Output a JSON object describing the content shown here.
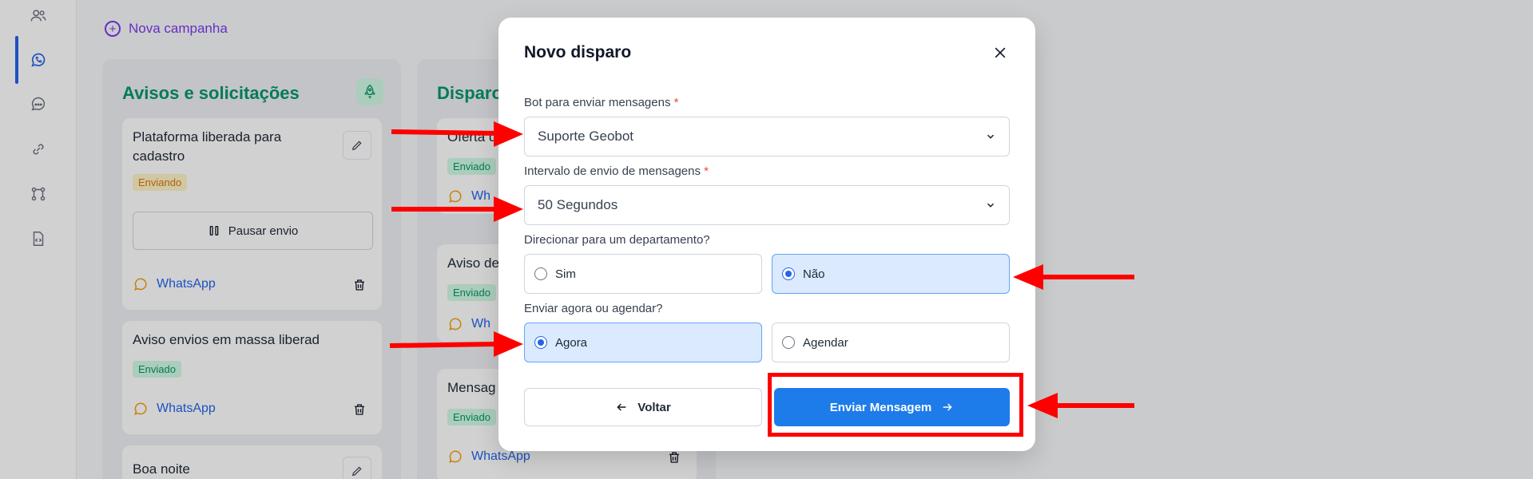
{
  "page": {
    "new_campaign": "Nova campanha"
  },
  "columns": [
    {
      "title": "Avisos e solicitações",
      "cards": [
        {
          "title_line1": "Plataforma liberada para",
          "title_line2": "cadastro",
          "status": "Enviando",
          "pause_label": "Pausar envio",
          "channel": "WhatsApp"
        },
        {
          "title_line1": "Aviso envios em massa liberad",
          "status": "Enviado",
          "channel": "WhatsApp"
        },
        {
          "title_line1": "Boa noite"
        }
      ]
    },
    {
      "title": "Disparo",
      "cards": [
        {
          "title_line1": "Oferta d",
          "status": "Enviado",
          "channel": "Wh"
        },
        {
          "title_line1": "Aviso de",
          "status": "Enviado",
          "channel": "Wh"
        },
        {
          "title_line1": "Mensag",
          "status": "Enviado",
          "channel": "WhatsApp"
        }
      ]
    }
  ],
  "modal": {
    "title": "Novo disparo",
    "bot_label": "Bot para enviar mensagens",
    "required_mark": "*",
    "bot_value": "Suporte Geobot",
    "interval_label": "Intervalo de envio de mensagens",
    "interval_value": "50 Segundos",
    "department_label": "Direcionar para um departamento?",
    "department_options": [
      "Sim",
      "Não"
    ],
    "department_selected": "Não",
    "schedule_label": "Enviar agora ou agendar?",
    "schedule_options": [
      "Agora",
      "Agendar"
    ],
    "schedule_selected": "Agora",
    "back_label": "Voltar",
    "send_label": "Enviar Mensagem"
  },
  "colors": {
    "accent_blue": "#1d7bea",
    "annotation_red": "#ff0000",
    "green_title": "#059669",
    "purple": "#7c3aed"
  }
}
